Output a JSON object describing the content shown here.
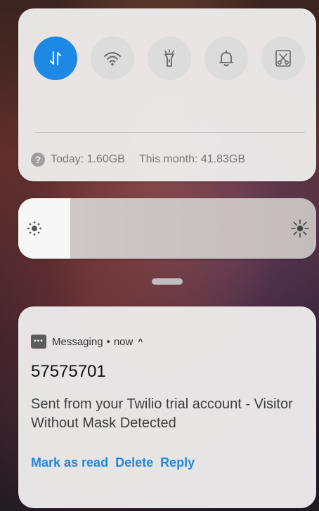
{
  "quick_panel": {
    "toggles": [
      {
        "name": "mobile-data",
        "icon": "data-arrows-icon",
        "active": true
      },
      {
        "name": "wifi",
        "icon": "wifi-icon",
        "active": false
      },
      {
        "name": "flashlight",
        "icon": "flashlight-icon",
        "active": false
      },
      {
        "name": "sound",
        "icon": "bell-icon",
        "active": false
      },
      {
        "name": "screenshot",
        "icon": "scissors-icon",
        "active": false
      }
    ],
    "usage": {
      "help_glyph": "?",
      "today": "Today: 1.60GB",
      "month": "This month: 41.83GB"
    }
  },
  "brightness": {
    "level": 0.175,
    "low_icon": "brightness-low-icon",
    "high_icon": "brightness-high-icon"
  },
  "notification": {
    "app_name": "Messaging",
    "separator": "•",
    "time": "now",
    "expand_glyph": "^",
    "sender": "57575701",
    "message": "Sent from your Twilio trial account - Visitor Without Mask Detected",
    "actions": {
      "mark_as_read": "Mark as read",
      "delete": "Delete",
      "reply": "Reply"
    }
  },
  "colors": {
    "accent": "#1e88e5",
    "panel": "#eeeded",
    "toggle_inactive": "#dcdcdc"
  }
}
